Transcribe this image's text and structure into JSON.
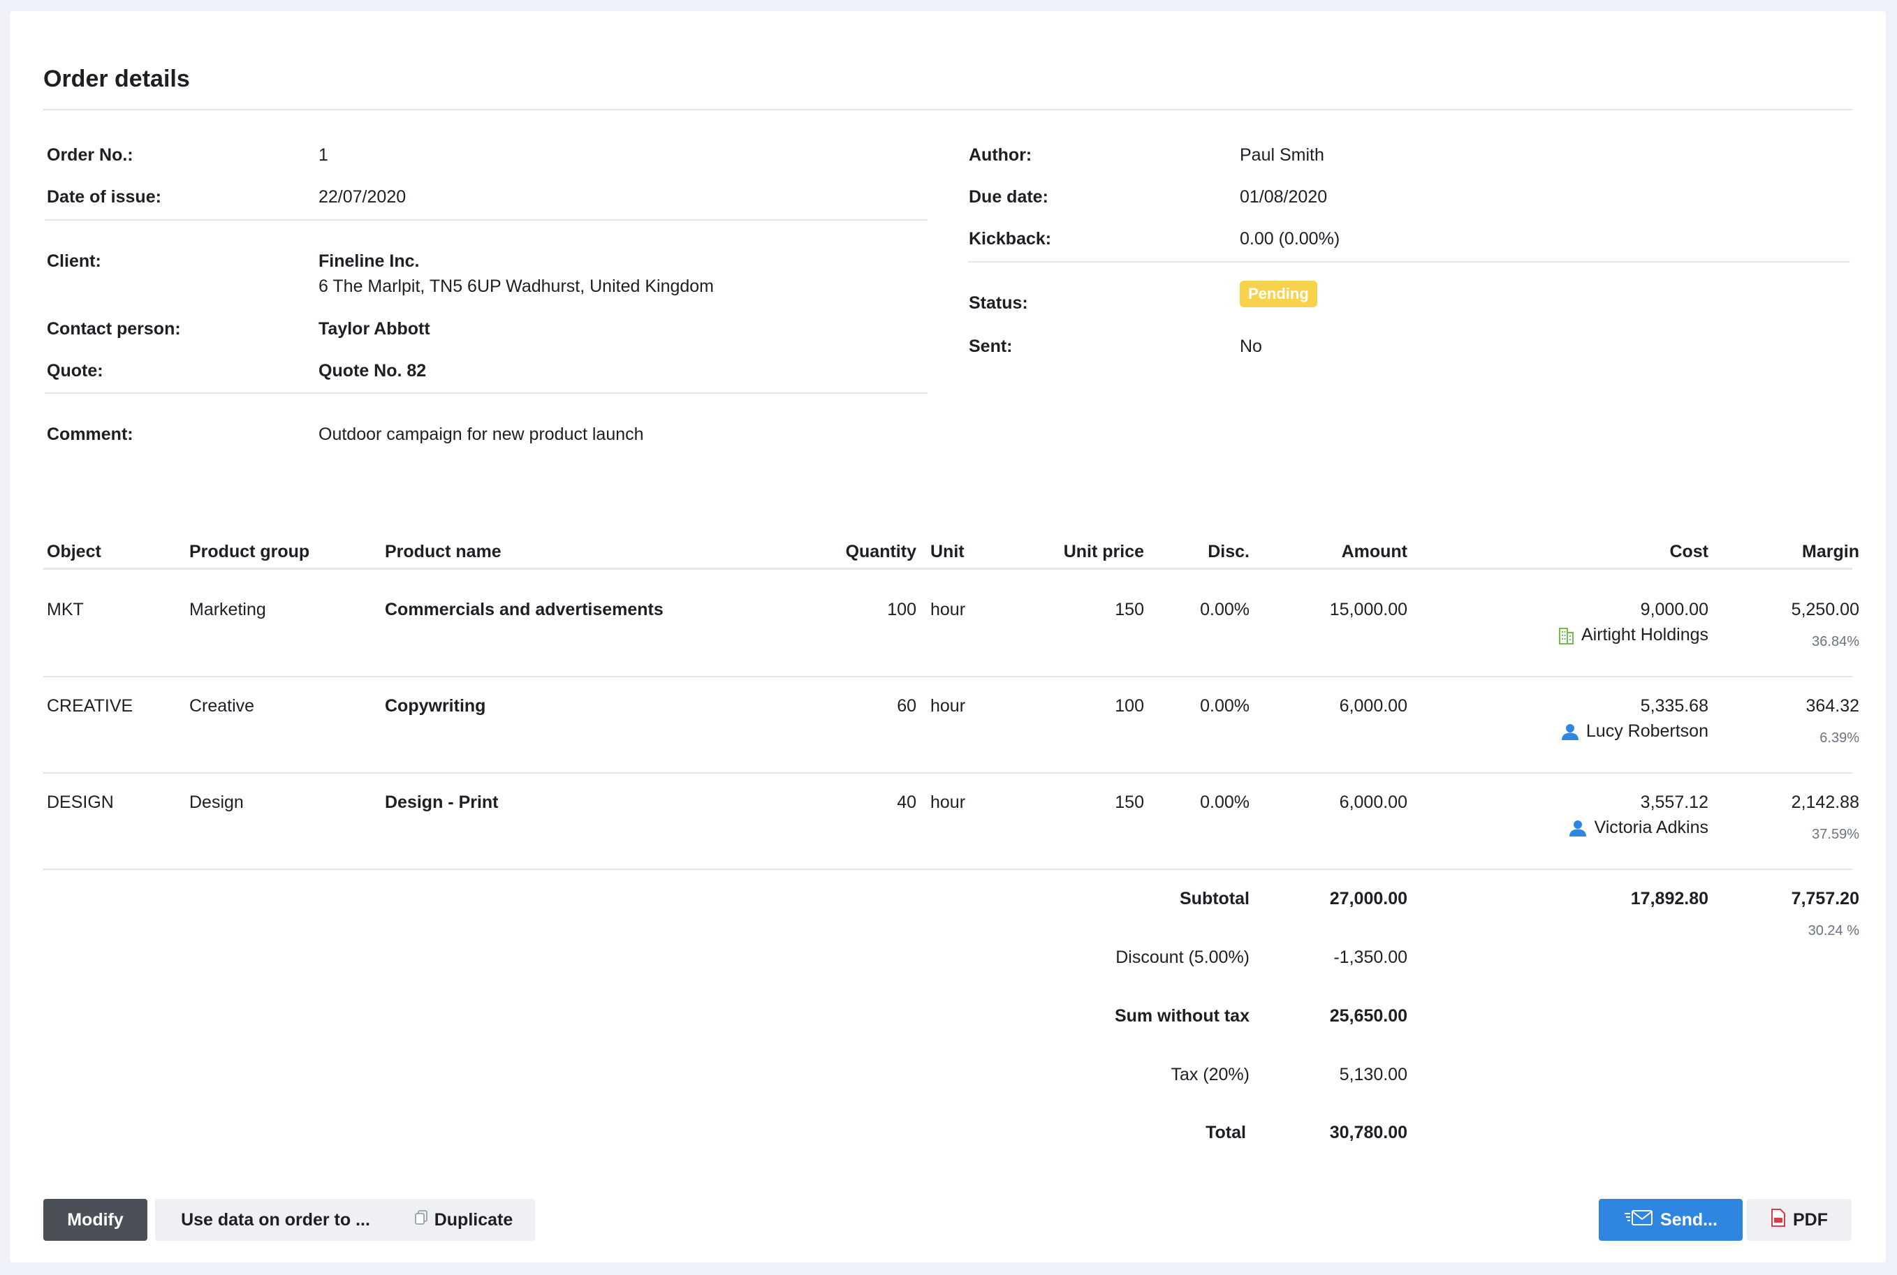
{
  "page": {
    "title": "Order details"
  },
  "info": {
    "order_no_label": "Order No.:",
    "order_no": "1",
    "date_issue_label": "Date of issue:",
    "date_issue": "22/07/2020",
    "client_label": "Client:",
    "client_name": "Fineline Inc.",
    "client_address": "6 The Marlpit, TN5 6UP Wadhurst, United Kingdom",
    "contact_label": "Contact person:",
    "contact": "Taylor Abbott",
    "quote_label": "Quote:",
    "quote": "Quote No. 82",
    "comment_label": "Comment:",
    "comment": "Outdoor campaign for new product launch",
    "author_label": "Author:",
    "author": "Paul Smith",
    "due_label": "Due date:",
    "due": "01/08/2020",
    "kickback_label": "Kickback:",
    "kickback": "0.00 (0.00%)",
    "status_label": "Status:",
    "status": "Pending",
    "sent_label": "Sent:",
    "sent": "No"
  },
  "colors": {
    "status_badge": "#f8d24a",
    "primary_button": "#2f86e0",
    "dark_button": "#4a4f58",
    "pdf_icon": "#e0394a",
    "building_icon": "#6fbf4f",
    "user_icon": "#2f86e0"
  },
  "table": {
    "headers": {
      "object": "Object",
      "group": "Product group",
      "name": "Product name",
      "qty": "Quantity",
      "unit": "Unit",
      "price": "Unit price",
      "disc": "Disc.",
      "amount": "Amount",
      "cost": "Cost",
      "margin": "Margin"
    },
    "rows": [
      {
        "object": "MKT",
        "group": "Marketing",
        "name": "Commercials and advertisements",
        "qty": "100",
        "unit": "hour",
        "price": "150",
        "disc": "0.00%",
        "amount": "15,000.00",
        "cost": "9,000.00",
        "supplier": "Airtight Holdings",
        "supplier_icon": "building-icon",
        "margin": "5,250.00",
        "margin_pct": "36.84%"
      },
      {
        "object": "CREATIVE",
        "group": "Creative",
        "name": "Copywriting",
        "qty": "60",
        "unit": "hour",
        "price": "100",
        "disc": "0.00%",
        "amount": "6,000.00",
        "cost": "5,335.68",
        "supplier": "Lucy Robertson",
        "supplier_icon": "user-icon",
        "margin": "364.32",
        "margin_pct": "6.39%"
      },
      {
        "object": "DESIGN",
        "group": "Design",
        "name": "Design - Print",
        "qty": "40",
        "unit": "hour",
        "price": "150",
        "disc": "0.00%",
        "amount": "6,000.00",
        "cost": "3,557.12",
        "supplier": "Victoria Adkins",
        "supplier_icon": "user-icon",
        "margin": "2,142.88",
        "margin_pct": "37.59%"
      }
    ]
  },
  "totals": {
    "subtotal_label": "Subtotal",
    "subtotal": "27,000.00",
    "subtotal_cost": "17,892.80",
    "subtotal_margin": "7,757.20",
    "subtotal_margin_pct": "30.24 %",
    "discount_label": "Discount (5.00%)",
    "discount": "-1,350.00",
    "sum_label": "Sum without tax",
    "sum": "25,650.00",
    "tax_label": "Tax (20%)",
    "tax": "5,130.00",
    "total_label": "Total",
    "total": "30,780.00"
  },
  "actions": {
    "modify": "Modify",
    "use_data": "Use data on order to ...",
    "duplicate": "Duplicate",
    "send": "Send...",
    "pdf": "PDF"
  }
}
